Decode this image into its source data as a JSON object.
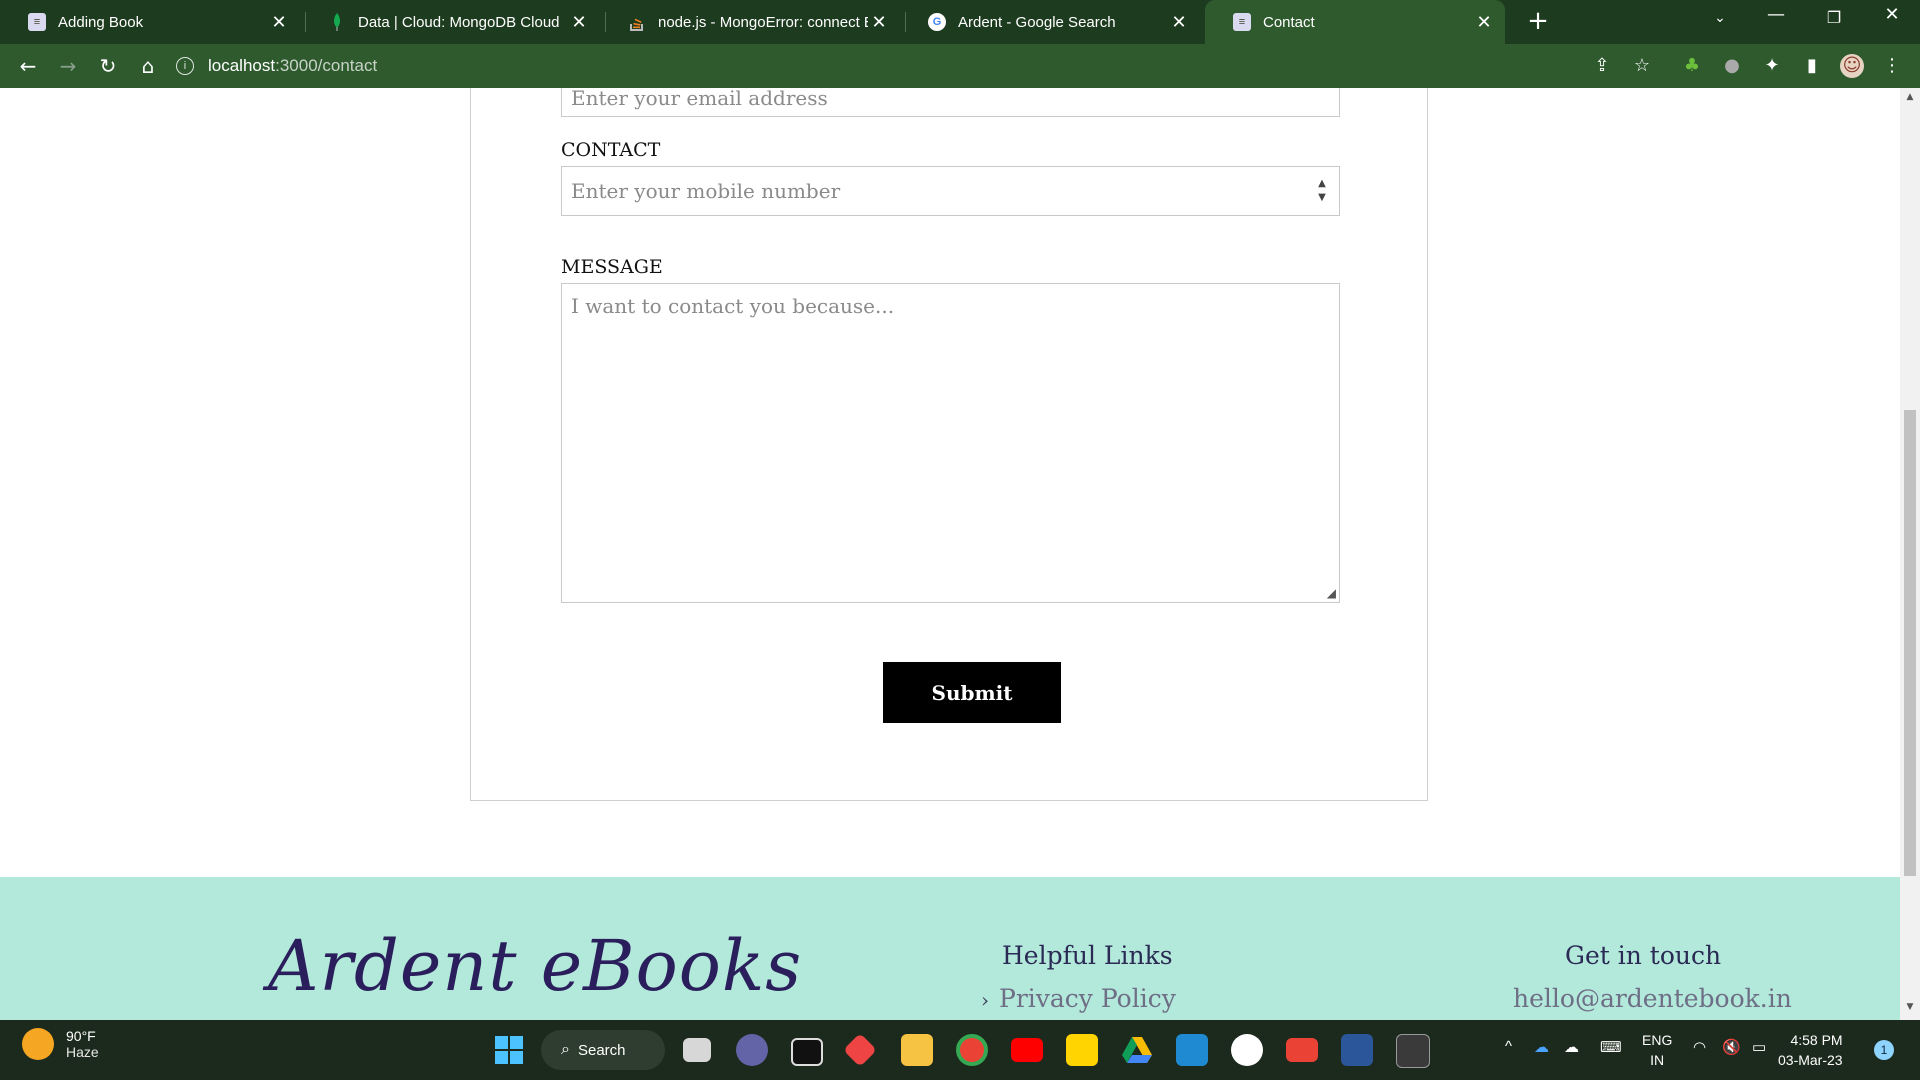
{
  "browser": {
    "tabs": [
      {
        "title": "Adding Book",
        "favicon": "books-icon",
        "active": false
      },
      {
        "title": "Data | Cloud: MongoDB Cloud",
        "favicon": "mongodb-leaf-icon",
        "active": false
      },
      {
        "title": "node.js - MongoError: connect EC",
        "favicon": "stackoverflow-icon",
        "active": false
      },
      {
        "title": "Ardent - Google Search",
        "favicon": "google-icon",
        "active": false
      },
      {
        "title": "Contact",
        "favicon": "books-icon",
        "active": true
      }
    ],
    "new_tab": "+",
    "close_glyph": "✕",
    "address": {
      "host": "localhost",
      "path": ":3000/contact"
    },
    "theme_color": "#2e5a2e"
  },
  "form": {
    "email": {
      "placeholder": "Enter your email address"
    },
    "contact": {
      "label": "CONTACT",
      "placeholder": "Enter your mobile number"
    },
    "message": {
      "label": "MESSAGE",
      "placeholder": "I want to contact you because..."
    },
    "submit_label": "Submit"
  },
  "footer": {
    "brand": "Ardent eBooks",
    "helpful_links": {
      "heading": "Helpful Links",
      "items": [
        "Privacy Policy"
      ]
    },
    "get_in_touch": {
      "heading": "Get in touch",
      "email": "hello@ardentebook.in"
    },
    "background": "#b3e9da"
  },
  "taskbar": {
    "weather": {
      "temp": "90°F",
      "condition": "Haze"
    },
    "search_label": "Search",
    "language": {
      "line1": "ENG",
      "line2": "IN"
    },
    "clock": {
      "time": "4:58 PM",
      "date": "03-Mar-23"
    },
    "notification_count": "1"
  }
}
